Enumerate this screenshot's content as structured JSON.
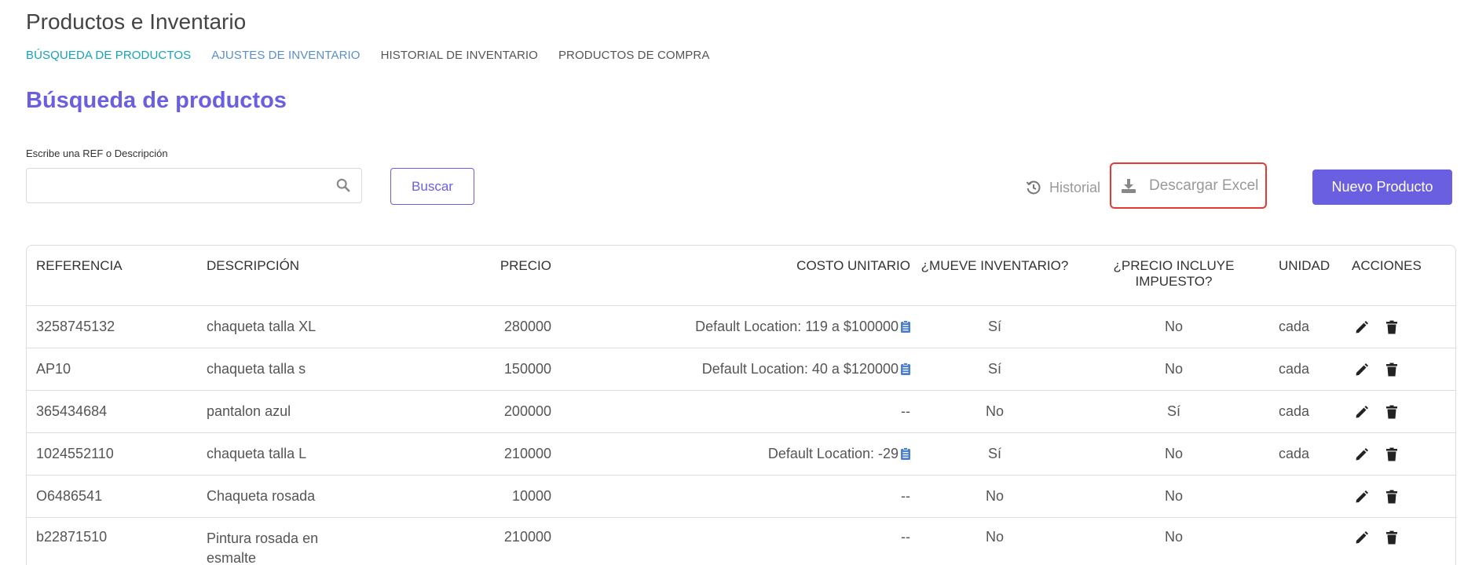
{
  "app": {
    "title": "Productos e Inventario"
  },
  "tabs": [
    {
      "label": "BÚSQUEDA DE PRODUCTOS"
    },
    {
      "label": "AJUSTES DE INVENTARIO"
    },
    {
      "label": "HISTORIAL DE INVENTARIO"
    },
    {
      "label": "PRODUCTOS DE COMPRA"
    }
  ],
  "section_title": "Búsqueda de productos",
  "search": {
    "label": "Escribe una REF o Descripción",
    "value": "",
    "placeholder": "",
    "button": "Buscar"
  },
  "toolbar": {
    "historial": "Historial",
    "descargar": "Descargar Excel",
    "nuevo": "Nuevo Producto"
  },
  "colors": {
    "accent": "#6a5fe0",
    "active_tab": "#17a2b8",
    "highlight": "#e53935",
    "icon_blue": "#4a7fcf"
  },
  "table": {
    "headers": {
      "referencia": "REFERENCIA",
      "descripcion": "DESCRIPCIÓN",
      "precio": "PRECIO",
      "costo": "COSTO UNITARIO",
      "mueve": "¿MUEVE INVENTARIO?",
      "incluye_line1": "¿PRECIO INCLUYE",
      "incluye_line2": "IMPUESTO?",
      "unidad": "UNIDAD",
      "acciones": "ACCIONES"
    },
    "rows": [
      {
        "ref": "3258745132",
        "desc": "chaqueta talla XL",
        "precio": "280000",
        "costo": "Default Location: 119 a $100000",
        "mueve": "Sí",
        "incluye": "No",
        "unidad": "cada"
      },
      {
        "ref": "AP10",
        "desc": "chaqueta talla s",
        "precio": "150000",
        "costo": "Default Location: 40 a $120000",
        "mueve": "Sí",
        "incluye": "No",
        "unidad": "cada"
      },
      {
        "ref": "365434684",
        "desc": "pantalon azul",
        "precio": "200000",
        "costo": "--",
        "mueve": "No",
        "incluye": "Sí",
        "unidad": "cada"
      },
      {
        "ref": "1024552110",
        "desc": "chaqueta talla L",
        "precio": "210000",
        "costo": "Default Location: -29",
        "mueve": "Sí",
        "incluye": "No",
        "unidad": "cada"
      },
      {
        "ref": "O6486541",
        "desc": "Chaqueta rosada",
        "precio": "10000",
        "costo": "--",
        "mueve": "No",
        "incluye": "No",
        "unidad": ""
      },
      {
        "ref": "b22871510",
        "desc": "Pintura rosada en esmalte",
        "precio": "210000",
        "costo": "--",
        "mueve": "No",
        "incluye": "No",
        "unidad": ""
      }
    ]
  }
}
